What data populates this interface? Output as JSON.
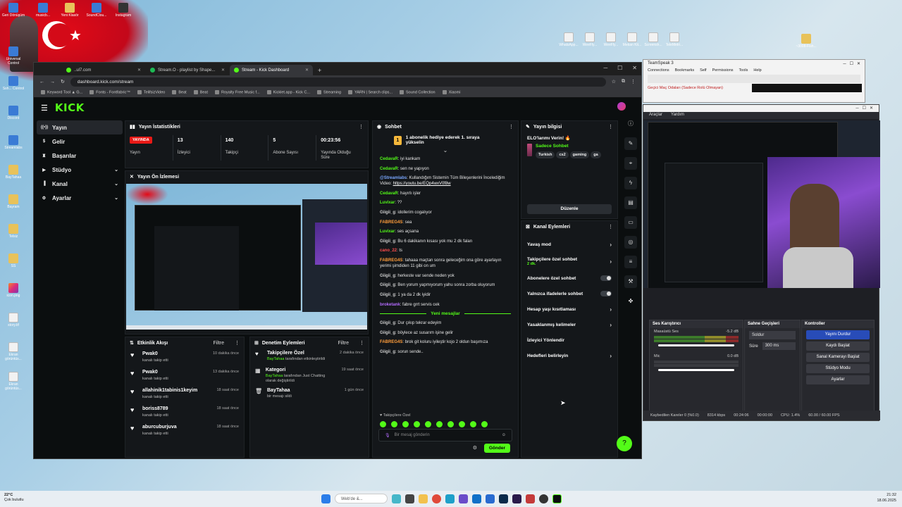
{
  "desktop": {
    "left_icons": [
      "Geri Dönüşüm",
      "Universal Control",
      "Ssh... Control",
      "Discord",
      "Streamlabs",
      "BayTahaa",
      "Bayram",
      "Telsiz",
      "SS",
      "icon.png",
      "story.tif",
      "Ekran görüntüs...",
      "Ekran görüntüs..."
    ],
    "top_icons": [
      "musicb...",
      "Yeni Klasör",
      "SoundClou...",
      "Instagram"
    ],
    "top_right_icons": [
      "WhatsApp...",
      "WeeFly...",
      "WeeFly...",
      "Mekan Kit...",
      "Screensh...",
      "TeleMetri..."
    ],
    "right_folder": "~3008-Fish..."
  },
  "browser": {
    "tabs": [
      {
        "label": "..ul7.com",
        "active": false
      },
      {
        "label": "Stream.O - playlist by Shape...",
        "active": false
      },
      {
        "label": "Stream - Kick Dashboard",
        "active": true
      }
    ],
    "url": "dashboard.kick.com/stream",
    "bookmarks": [
      "Keyword Tool ▲ G...",
      "Fonts - Fontfabric™",
      "TelifsizVideo",
      "Beat",
      "Beat",
      "Royalty Free Music f...",
      "Kicklet.app - Kick C...",
      "Streaming",
      "YARN | Search clips...",
      "Sound Collection",
      "Xiaomi"
    ]
  },
  "kick": {
    "logo": "KICK",
    "sidebar": [
      {
        "label": "Yayın",
        "icon": "stream-icon",
        "active": true,
        "chevron": false
      },
      {
        "label": "Gelir",
        "icon": "revenue-icon",
        "active": false,
        "chevron": false
      },
      {
        "label": "Başarılar",
        "icon": "achievements-icon",
        "active": false,
        "chevron": false
      },
      {
        "label": "Stüdyo",
        "icon": "studio-icon",
        "active": false,
        "chevron": true
      },
      {
        "label": "Kanal",
        "icon": "channel-icon",
        "active": false,
        "chevron": true
      },
      {
        "label": "Ayarlar",
        "icon": "settings-icon",
        "active": false,
        "chevron": true
      }
    ],
    "stats": {
      "title": "Yayın İstatistikleri",
      "items": [
        {
          "value": "YAYINDA",
          "label": "Yayın"
        },
        {
          "value": "13",
          "label": "İzleyici"
        },
        {
          "value": "140",
          "label": "Takipçi"
        },
        {
          "value": "5",
          "label": "Abone Sayısı"
        },
        {
          "value": "00:23:56",
          "label": "Yayında Olduğu Süre"
        }
      ]
    },
    "preview_title": "Yayın Ön İzlemesi",
    "activity": {
      "title": "Etkinlik Akışı",
      "filter": "Filtre",
      "items": [
        {
          "name": "Pwak0",
          "sub": "kanalı takip etti",
          "time": "10 dakika önce"
        },
        {
          "name": "Pwak0",
          "sub": "kanalı takip etti",
          "time": "13 dakika önce"
        },
        {
          "name": "allahinik1tabinis1keyim",
          "sub": "kanalı takip etti",
          "time": "18 saat önce"
        },
        {
          "name": "boriss8789",
          "sub": "kanalı takip etti",
          "time": "18 saat önce"
        },
        {
          "name": "aburcuburjuva",
          "sub": "kanalı takip etti",
          "time": "18 saat önce"
        }
      ]
    },
    "moderation": {
      "title": "Denetim Eylemleri",
      "filter": "Filtre",
      "items": [
        {
          "name": "Takipçilere Özel",
          "actor": "BayTahaa",
          "rest": " tarafından etkinleştirildi",
          "time": "2 dakika önce"
        },
        {
          "name": "Kategori",
          "actor": "BayTahaa",
          "rest": " tarafından Just Chatting olarak değiştirildi",
          "time": "19 saat önce"
        },
        {
          "name": "BayTahaa",
          "actor": "",
          "rest": "bir mesajı sildi",
          "time": "1 gün önce"
        }
      ]
    },
    "chat": {
      "title": "Sohbet",
      "pinned": "1 abonelik hediye ederek 1. sıraya yükselin",
      "messages": [
        {
          "user": "CedavaR",
          "color": "#53fc18",
          "text": "iyi kankam"
        },
        {
          "user": "CedavaR",
          "color": "#53fc18",
          "text": "sen ne yapıyon"
        },
        {
          "user": "@Streamlabs",
          "color": "#7aa7ff",
          "text": "Kullandığım Sistemin Tüm Bileşenlerini İncelediğim Video: ",
          "link": "https://youtu.be/EQp4wxV0f8w"
        },
        {
          "user": "CedavaR",
          "color": "#53fc18",
          "text": "hayırlı işler"
        },
        {
          "user": "Luvixar",
          "color": "#53fc18",
          "text": "??"
        },
        {
          "user": "Giigii_g",
          "color": "#cccccc",
          "text": "idollerim cogalıyor"
        },
        {
          "user": "FABREG4S",
          "color": "#ff9d3b",
          "text": "sea"
        },
        {
          "user": "Luvixar",
          "color": "#53fc18",
          "text": "ses açsana"
        },
        {
          "user": "Giigii_g",
          "color": "#cccccc",
          "text": "Bu 6 dakikanın kısası yok mu 2 dk falan"
        },
        {
          "user": "cano_22",
          "color": "#ff4d4d",
          "text": "ts"
        },
        {
          "user": "FABREG4S",
          "color": "#ff9d3b",
          "text": "tahaaa maçtan sonra geleceğim ona göre ayarlayın yerimi şimdiden 11 gibi on um"
        },
        {
          "user": "Giigii_g",
          "color": "#cccccc",
          "text": "herkeste var sende neden yok"
        },
        {
          "user": "Giigii_g",
          "color": "#cccccc",
          "text": "Ben yorum yapmıyorum yahu sonra zorba oluyorum"
        },
        {
          "user": "Giigii_g",
          "color": "#cccccc",
          "text": "1 ya da 2 dk iyidir"
        },
        {
          "user": "broketank",
          "color": "#b56cff",
          "text": "fabre grrt servis cek"
        }
      ],
      "new_label": "Yeni mesajlar",
      "new_messages": [
        {
          "user": "Giigii_g",
          "color": "#cccccc",
          "text": "Dur çıkıp tekrar edeyim"
        },
        {
          "user": "Giigii_g",
          "color": "#cccccc",
          "text": "böylece az susarım işine gelir"
        },
        {
          "user": "FABREG4S",
          "color": "#ff9d3b",
          "text": "brok git koluru iyileştir kojo 2 oldun başımıza"
        },
        {
          "user": "Giigii_g",
          "color": "#cccccc",
          "text": "sorun sende.."
        }
      ],
      "followers_only": "Takipçilere Özel",
      "input_placeholder": "Bir mesaj gönderin",
      "send": "Gönder"
    },
    "stream_info": {
      "title": "Yayın bilgisi",
      "stream_title": "ELO'larımı Verin! 🔥",
      "category": "Sadece Sohbet",
      "tags": [
        "Turkish",
        "cs2",
        "gaming",
        "ga"
      ],
      "edit": "Düzenle"
    },
    "channel_actions": {
      "title": "Kanal Eylemleri",
      "items": [
        {
          "label": "Yavaş mod",
          "sub": "",
          "type": "chevron"
        },
        {
          "label": "Takipçilere özel sohbet",
          "sub": "2 dk.",
          "type": "chevron"
        },
        {
          "label": "Abonelere özel sohbet",
          "sub": "",
          "type": "toggle"
        },
        {
          "label": "Yalnızca ifadelerle sohbet",
          "sub": "",
          "type": "toggle"
        },
        {
          "label": "Hesap yaşı kısıtlaması",
          "sub": "",
          "type": "chevron"
        },
        {
          "label": "Yasaklanmış kelimeler",
          "sub": "",
          "type": "chevron"
        },
        {
          "label": "İzleyici Yönlendir",
          "sub": "",
          "type": "none"
        },
        {
          "label": "Hedefleri belirleyin",
          "sub": "",
          "type": "chevron"
        }
      ]
    }
  },
  "teamspeak": {
    "title": "TeamSpeak 3",
    "menu": [
      "Connections",
      "Bookmarks",
      "Self",
      "Permissions",
      "Tools",
      "Help"
    ],
    "channel": "Geçici Maç Odaları (Sadece Rolü Olmayan)"
  },
  "obs": {
    "menu": [
      "Araçlar",
      "Yardım"
    ],
    "mixer_title": "Ses Karıştırıcı",
    "mixer": [
      {
        "name": "Masaüstü Ses",
        "db": "-5.2 dB"
      },
      {
        "name": "Mic",
        "db": "0.0 dB"
      }
    ],
    "transitions_title": "Sahne Geçişleri",
    "transition": "Soldur",
    "duration_label": "Süre",
    "duration": "300 ms",
    "controls_title": "Kontroller",
    "controls": [
      "Yayını Durdur",
      "Kaydı Başlat",
      "Sanal Kamerayı Başlat",
      "Stüdyo Modu",
      "Ayarlar"
    ],
    "status": [
      "Kaybedilen Kareler 0 (%0.0)",
      "8314 kbps",
      "00:24:06",
      "00:00:00",
      "CPU: 1.4%",
      "60.00 / 60.00 FPS"
    ]
  },
  "taskbar": {
    "temp": "22°C",
    "weather": "Çok bulutlu",
    "search": "Web'de &...",
    "time": "21:32",
    "date": "18.06.2025"
  }
}
